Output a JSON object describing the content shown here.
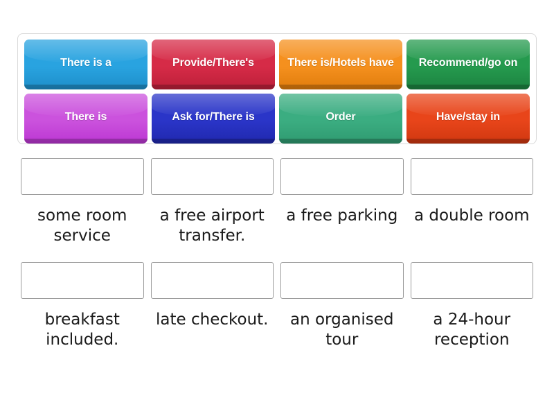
{
  "activity": {
    "type": "match-up-drag-and-drop"
  },
  "tray": {
    "tiles": [
      {
        "label": "There is a",
        "color": "#29a3e0",
        "color_dark": "#1d8ec9"
      },
      {
        "label": "Provide/There's",
        "color": "#d62b47",
        "color_dark": "#bc1f39"
      },
      {
        "label": "There is/Hotels have",
        "color": "#f5901e",
        "color_dark": "#e07c0c"
      },
      {
        "label": "Recommend/go on",
        "color": "#259a4e",
        "color_dark": "#1c8240"
      },
      {
        "label": "There is",
        "color": "#cb52dd",
        "color_dark": "#bb36d2"
      },
      {
        "label": "Ask for/There is",
        "color": "#2a35c8",
        "color_dark": "#2028ad"
      },
      {
        "label": "Order",
        "color": "#3bad81",
        "color_dark": "#2f9a70"
      },
      {
        "label": "Have/stay in",
        "color": "#e8451a",
        "color_dark": "#cf3710"
      }
    ]
  },
  "answers": {
    "rows": [
      [
        {
          "label": "some room service",
          "drop_value": ""
        },
        {
          "label": "a free airport transfer.",
          "drop_value": ""
        },
        {
          "label": "a free parking",
          "drop_value": ""
        },
        {
          "label": "a double room",
          "drop_value": ""
        }
      ],
      [
        {
          "label": "breakfast included.",
          "drop_value": ""
        },
        {
          "label": "late checkout.",
          "drop_value": ""
        },
        {
          "label": "an organised tour",
          "drop_value": ""
        },
        {
          "label": "a 24-hour reception",
          "drop_value": ""
        }
      ]
    ]
  }
}
